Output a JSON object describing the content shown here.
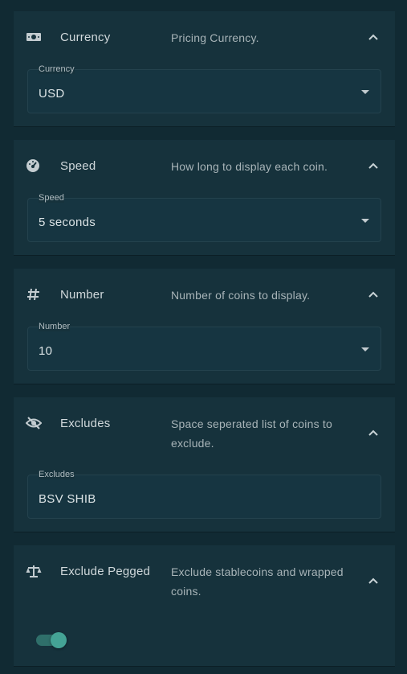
{
  "settings": [
    {
      "title": "Currency",
      "description": "Pricing Currency.",
      "icon": "money-icon",
      "field": {
        "label": "Currency",
        "value": "USD",
        "type": "select"
      }
    },
    {
      "title": "Speed",
      "description": "How long to display each coin.",
      "icon": "speedometer-icon",
      "field": {
        "label": "Speed",
        "value": "5 seconds",
        "type": "select"
      }
    },
    {
      "title": "Number",
      "description": "Number of coins to display.",
      "icon": "hash-icon",
      "field": {
        "label": "Number",
        "value": "10",
        "type": "select"
      }
    },
    {
      "title": "Excludes",
      "description": "Space seperated list of coins to exclude.",
      "icon": "eye-off-icon",
      "field": {
        "label": "Excludes",
        "value": "BSV SHIB",
        "type": "text"
      }
    },
    {
      "title": "Exclude Pegged",
      "description": "Exclude stablecoins and wrapped coins.",
      "icon": "scale-icon",
      "toggle": {
        "on": true
      }
    }
  ],
  "colors": {
    "background": "#112a33",
    "panel": "#16323c",
    "accent": "#44a395"
  }
}
